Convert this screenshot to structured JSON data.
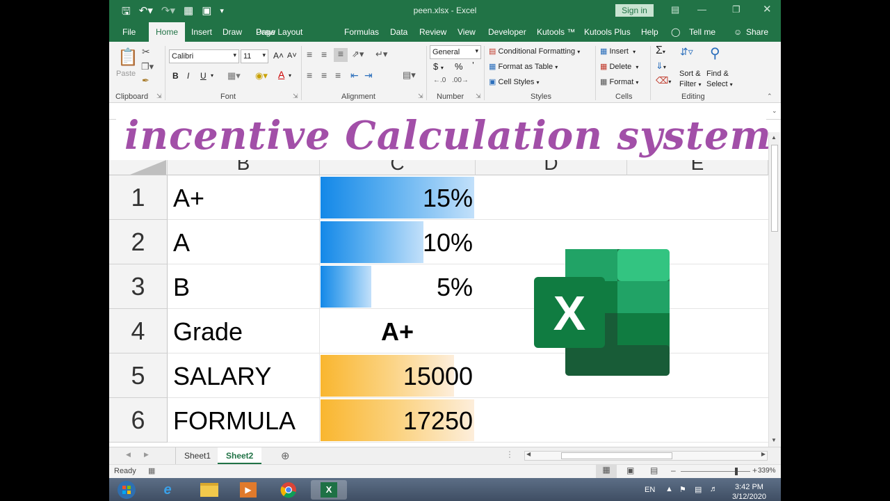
{
  "titlebar": {
    "doc_title": "peen.xlsx  -  Excel",
    "signin": "Sign in",
    "qat": [
      "save-icon",
      "undo-icon",
      "redo-icon",
      "form-icon",
      "screen-icon",
      "customize-icon"
    ]
  },
  "tabs": [
    "File",
    "Home",
    "Insert",
    "Draw",
    "Page Layout",
    "Formulas",
    "Data",
    "Review",
    "View",
    "Developer",
    "Kutools ™",
    "Kutools Plus",
    "Help",
    "Tell me",
    "Share"
  ],
  "ribbon": {
    "clipboard": {
      "paste": "Paste",
      "label": "Clipboard"
    },
    "font": {
      "name": "Calibri",
      "size": "11",
      "label": "Font",
      "bold": "B",
      "italic": "I",
      "underline": "U"
    },
    "alignment": {
      "label": "Alignment"
    },
    "number": {
      "format": "General",
      "currency": "$",
      "percent": "%",
      "comma": "’",
      "label": "Number"
    },
    "styles": {
      "conditional": "Conditional Formatting",
      "table": "Format as Table",
      "cell": "Cell Styles",
      "label": "Styles"
    },
    "cells": {
      "insert": "Insert",
      "delete": "Delete",
      "format": "Format",
      "label": "Cells"
    },
    "editing": {
      "sort": "Sort &",
      "filter": "Filter",
      "find": "Find &",
      "select": "Select",
      "label": "Editing"
    }
  },
  "banner": "incentive Calculation system",
  "columns": [
    "B",
    "C",
    "D",
    "E"
  ],
  "rows": [
    {
      "num": "1",
      "label": "A+",
      "value": "15%",
      "bar": "blue",
      "fill": 1.0
    },
    {
      "num": "2",
      "label": "A",
      "value": "10%",
      "bar": "blue",
      "fill": 0.67
    },
    {
      "num": "3",
      "label": "B",
      "value": "5%",
      "bar": "blue",
      "fill": 0.33
    },
    {
      "num": "4",
      "label": "Grade",
      "value": "A+",
      "bar": "none",
      "fill": 0
    },
    {
      "num": "5",
      "label": "SALARY",
      "value": "15000",
      "bar": "orange",
      "fill": 0.87
    },
    {
      "num": "6",
      "label": "FORMULA",
      "value": "17250",
      "bar": "orange",
      "fill": 1.0
    }
  ],
  "sheets": [
    "Sheet1",
    "Sheet2"
  ],
  "active_sheet": "Sheet2",
  "status": {
    "ready": "Ready",
    "zoom": "339%"
  },
  "taskbar": {
    "lang": "EN",
    "time": "3:42 PM",
    "date": "3/12/2020"
  },
  "colors": {
    "excel_green": "#217346",
    "banner": "#a24fa8",
    "databar_blue": "#1388e8",
    "databar_orange": "#f9b62f"
  }
}
